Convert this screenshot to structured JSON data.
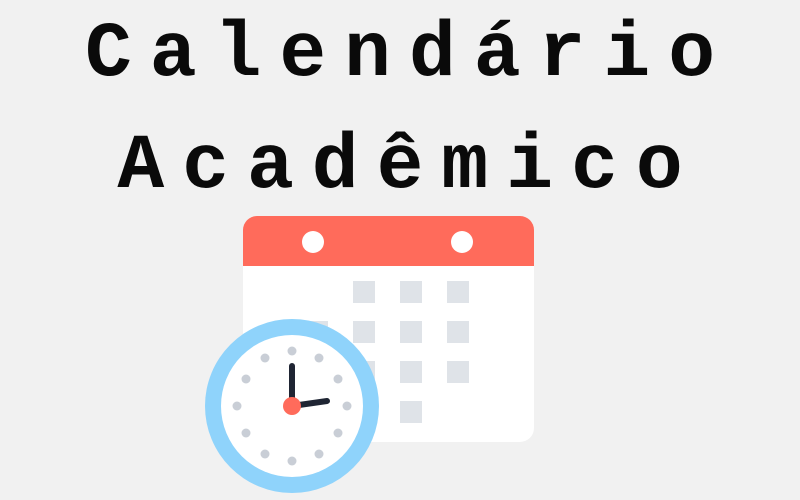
{
  "title": {
    "line1": "Calendário",
    "line2": "Acadêmico"
  },
  "illustration": {
    "icon": "calendar-clock-icon",
    "colors": {
      "background": "#f1f1f1",
      "calendar_header": "#ff6b5b",
      "calendar_body": "#ffffff",
      "calendar_cells": "#dfe3e8",
      "clock_ring": "#8fd3fb",
      "clock_face": "#ffffff",
      "clock_hands": "#1f2533",
      "clock_center": "#ff6b5b",
      "clock_dots": "#c9ced6"
    }
  }
}
